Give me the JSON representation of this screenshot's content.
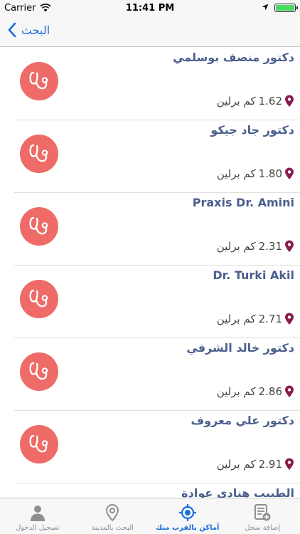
{
  "status_bar": {
    "carrier": "Carrier",
    "time": "11:41 PM"
  },
  "nav": {
    "back_label": "البحث"
  },
  "results": [
    {
      "name": "دكتور منصف بوسلمي",
      "distance": "1.62",
      "unit": "كم برلين"
    },
    {
      "name": "دكتور جاد جيكو",
      "distance": "1.80",
      "unit": "كم برلين"
    },
    {
      "name": "Praxis Dr. Amini",
      "distance": "2.31",
      "unit": "كم برلين"
    },
    {
      "name": "Dr. Turki Akil",
      "distance": "2.71",
      "unit": "كم برلين"
    },
    {
      "name": "دكتور خالد الشرفي",
      "distance": "2.86",
      "unit": "كم برلين"
    },
    {
      "name": "دكتور علي معروف",
      "distance": "2.91",
      "unit": "كم برلين"
    },
    {
      "name": "الطبيب هنادى عوادة",
      "distance": "",
      "unit": ""
    }
  ],
  "tabs": [
    {
      "label": "تسجيل الدخول",
      "icon": "person-icon",
      "active": false
    },
    {
      "label": "البحث بالمدينة",
      "icon": "map-pin-icon",
      "active": false
    },
    {
      "label": "أماكن بالقرب منك",
      "icon": "location-target-icon",
      "active": true
    },
    {
      "label": "إضافة سجل",
      "icon": "add-record-icon",
      "active": false
    }
  ],
  "colors": {
    "accent": "#1a6de0",
    "avatar_bg": "#ee6b67",
    "name_text": "#4a5f8c",
    "pin": "#8b1a4e"
  }
}
